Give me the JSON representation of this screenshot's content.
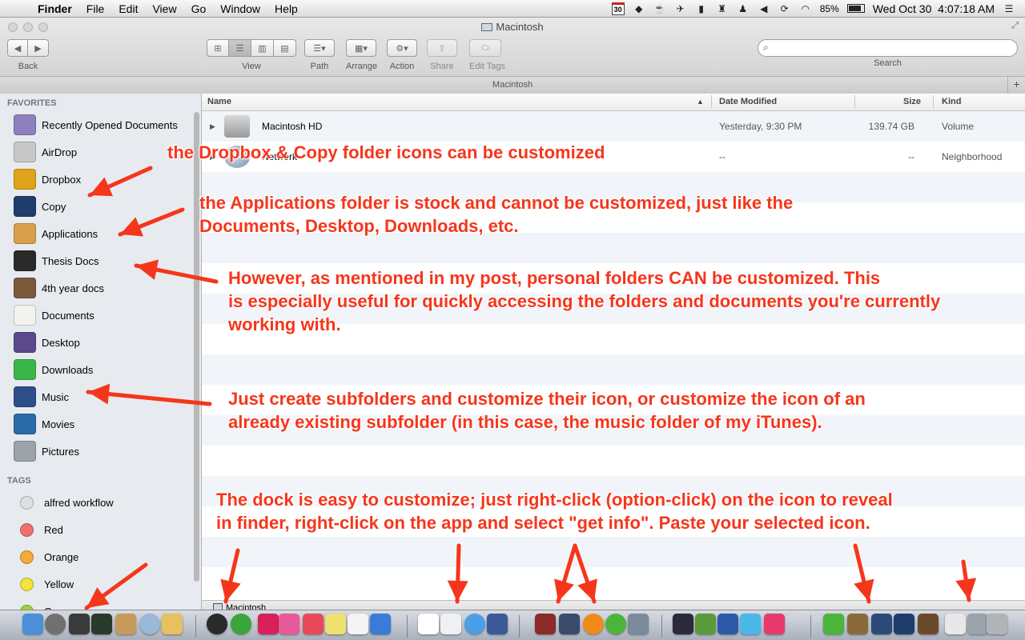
{
  "menubar": {
    "apple_glyph": "",
    "items": [
      "Finder",
      "File",
      "Edit",
      "View",
      "Go",
      "Window",
      "Help"
    ],
    "status": {
      "calendar_day": "30",
      "battery_percent": "85%",
      "battery_level": 0.85,
      "datetime": "Wed Oct 30  4:07:18 AM"
    }
  },
  "window": {
    "title": "Macintosh",
    "toolbar": {
      "back_label": "Back",
      "view_label": "View",
      "path_label": "Path",
      "arrange_label": "Arrange",
      "action_label": "Action",
      "share_label": "Share",
      "edit_tags_label": "Edit Tags",
      "search_label": "Search",
      "search_placeholder": ""
    },
    "path_title": "Macintosh"
  },
  "sidebar": {
    "favorites_header": "FAVORITES",
    "favorites": [
      {
        "label": "Recently Opened Documents",
        "icon": "gear-folder-icon",
        "color": "#8e7fbf"
      },
      {
        "label": "AirDrop",
        "icon": "airdrop-icon",
        "color": "#c8c8c8"
      },
      {
        "label": "Dropbox",
        "icon": "dropbox-icon",
        "color": "#e0a21a"
      },
      {
        "label": "Copy",
        "icon": "copy-app-icon",
        "color": "#1e3d6b"
      },
      {
        "label": "Applications",
        "icon": "applications-icon",
        "color": "#d8a04a"
      },
      {
        "label": "Thesis Docs",
        "icon": "briefcase-icon",
        "color": "#2a2a2a"
      },
      {
        "label": "4th year docs",
        "icon": "books-icon",
        "color": "#7a5a3a"
      },
      {
        "label": "Documents",
        "icon": "document-icon",
        "color": "#f2f2ee"
      },
      {
        "label": "Desktop",
        "icon": "desktop-icon",
        "color": "#5a4a8a"
      },
      {
        "label": "Downloads",
        "icon": "downloads-icon",
        "color": "#3ab54a"
      },
      {
        "label": "Music",
        "icon": "itunes-music-icon",
        "color": "#2c4f8c"
      },
      {
        "label": "Movies",
        "icon": "film-icon",
        "color": "#2a6aa8"
      },
      {
        "label": "Pictures",
        "icon": "camera-icon",
        "color": "#9aa2aa"
      }
    ],
    "tags_header": "TAGS",
    "tags": [
      {
        "label": "alfred workflow",
        "color": "#e0e0e0"
      },
      {
        "label": "Red",
        "color": "#f26f6f"
      },
      {
        "label": "Orange",
        "color": "#f7a93a"
      },
      {
        "label": "Yellow",
        "color": "#f5e23a"
      },
      {
        "label": "Green",
        "color": "#9ad53a"
      }
    ]
  },
  "file_list": {
    "columns": {
      "name": "Name",
      "date": "Date Modified",
      "size": "Size",
      "kind": "Kind"
    },
    "rows": [
      {
        "name": "Macintosh HD",
        "date": "Yesterday, 9:30 PM",
        "size": "139.74 GB",
        "kind": "Volume",
        "icon": "hard-drive-icon"
      },
      {
        "name": "Network",
        "date": "--",
        "size": "--",
        "kind": "Neighborhood",
        "icon": "network-globe-icon"
      }
    ],
    "status_text": "Macintosh"
  },
  "annotations": {
    "note1": "the Dropbox & Copy folder icons can be customized",
    "note2_line1": "the Applications folder is stock and cannot be customized, just like the",
    "note2_line2": "Documents, Desktop, Downloads, etc.",
    "note3_line1": "However, as mentioned in my post, personal folders CAN be customized. This",
    "note3_line2": "is especially useful for quickly accessing the folders and documents you're currently",
    "note3_line3": "working with.",
    "note4_line1": "Just create subfolders and customize their icon, or customize the icon of an",
    "note4_line2": "already existing subfolder (in this case, the music folder of my iTunes).",
    "note5_line1": "The dock is easy to customize; just right-click (option-click) on the icon to reveal",
    "note5_line2": "in finder, right-click on the app and select \"get info\". Paste your selected icon.",
    "arrow_color": "#f5361b"
  },
  "dock": {
    "icons": [
      {
        "name": "finder-icon",
        "color": "#4a8fd8"
      },
      {
        "name": "launchpad-icon",
        "color": "#707070"
      },
      {
        "name": "preview-icon",
        "color": "#3a3a3a"
      },
      {
        "name": "activity-monitor-icon",
        "color": "#2a3a2a"
      },
      {
        "name": "archive-box-icon",
        "color": "#c89a5a"
      },
      {
        "name": "network-radar-icon",
        "color": "#9ab8d8"
      },
      {
        "name": "photo-app-icon",
        "color": "#e8c060"
      },
      {
        "name": "clock-icon",
        "color": "#2a2a2a"
      },
      {
        "name": "colorful-wheel-icon",
        "color": "#3aa53a"
      },
      {
        "name": "unicode-u-icon",
        "color": "#d8205a"
      },
      {
        "name": "star-app-icon",
        "color": "#e85a9a"
      },
      {
        "name": "pocket-icon",
        "color": "#e84a5a"
      },
      {
        "name": "stickies-icon",
        "color": "#f0e070"
      },
      {
        "name": "notes-icon",
        "color": "#f4f4f4"
      },
      {
        "name": "save-app-icon",
        "color": "#3a7ad8"
      },
      {
        "name": "calendar-icon",
        "color": "#ffffff"
      },
      {
        "name": "mail-icon",
        "color": "#f0f0f0"
      },
      {
        "name": "messages-icon",
        "color": "#4aa0e8"
      },
      {
        "name": "facebook-icon",
        "color": "#3b5998"
      },
      {
        "name": "photo-booth-icon",
        "color": "#8a2a2a"
      },
      {
        "name": "network-folder-icon",
        "color": "#3a4a6a"
      },
      {
        "name": "vlc-icon",
        "color": "#f08a1a"
      },
      {
        "name": "utorrent-icon",
        "color": "#4ab53a"
      },
      {
        "name": "tools-icon",
        "color": "#7a8a9a"
      },
      {
        "name": "screenshot-icon",
        "color": "#2a2a3a"
      },
      {
        "name": "shield-icon",
        "color": "#5a9a3a"
      },
      {
        "name": "word-icon",
        "color": "#2a5aa8"
      },
      {
        "name": "cloud-app-icon",
        "color": "#4ab8e8"
      },
      {
        "name": "lips-app-icon",
        "color": "#e83a6a"
      },
      {
        "name": "utorrent-folder-icon",
        "color": "#4ab53a"
      },
      {
        "name": "briefcase-folder-icon",
        "color": "#8a6a3a"
      },
      {
        "name": "film-folder-icon",
        "color": "#2a4a7a"
      },
      {
        "name": "copy-folder-icon",
        "color": "#1e3d6b"
      },
      {
        "name": "books-folder-icon",
        "color": "#6a4a2a"
      },
      {
        "name": "documents-stack-icon",
        "color": "#e8e8e8"
      },
      {
        "name": "downloads-stack-icon",
        "color": "#9aa2aa"
      },
      {
        "name": "trash-icon",
        "color": "#b0b4b8"
      }
    ]
  }
}
